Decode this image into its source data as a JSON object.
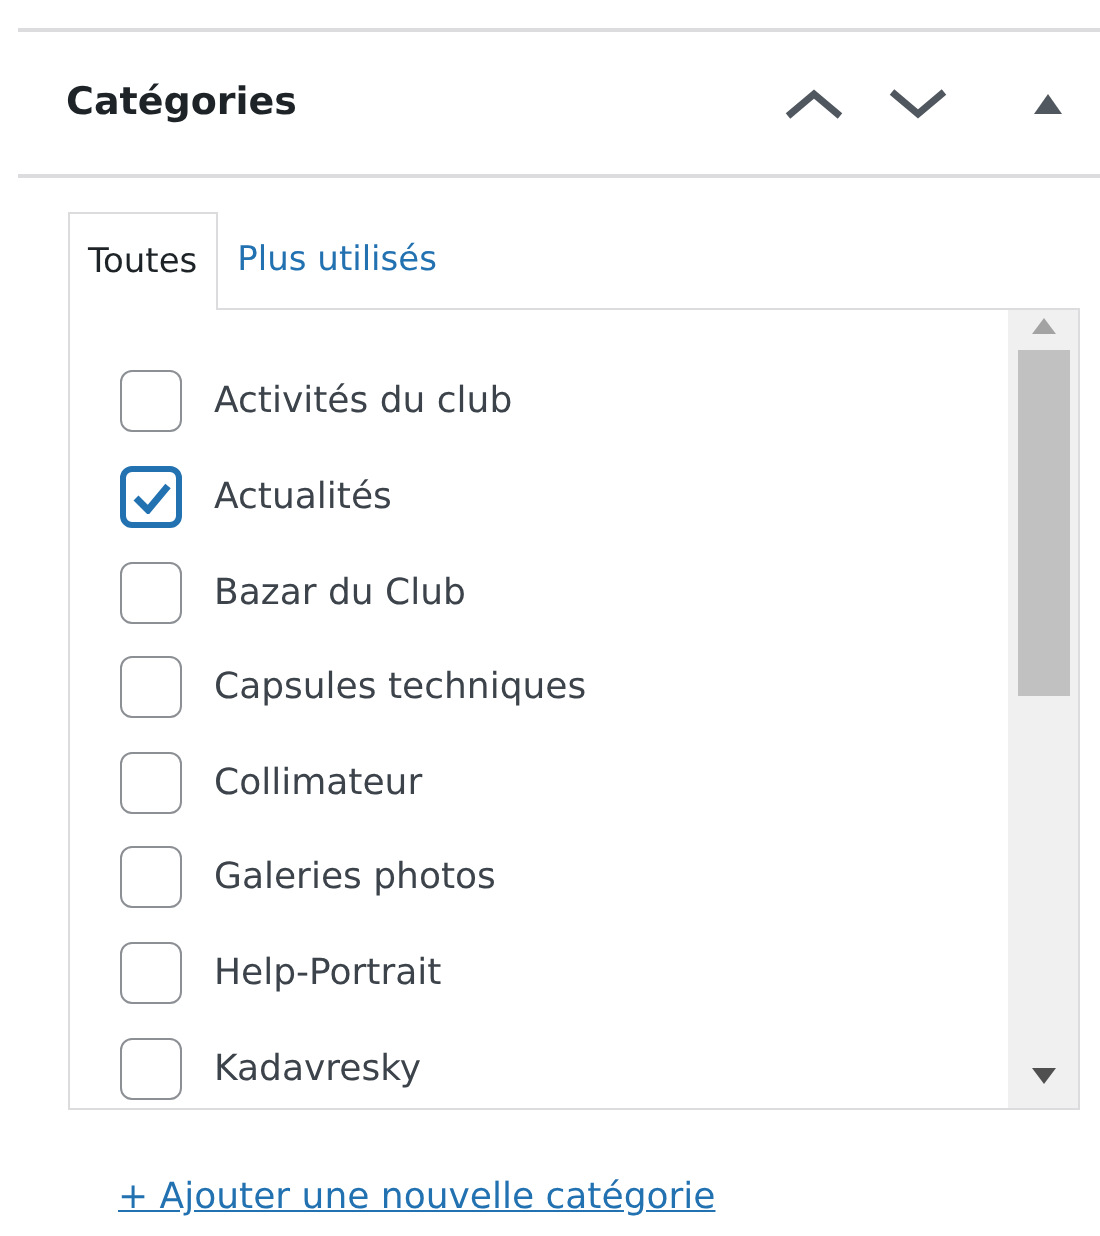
{
  "panel": {
    "title": "Catégories"
  },
  "tabs": [
    {
      "label": "Toutes",
      "selected": true
    },
    {
      "label": "Plus utilisés",
      "selected": false
    }
  ],
  "categories": [
    {
      "label": "Activités du club",
      "checked": false
    },
    {
      "label": "Actualités",
      "checked": true
    },
    {
      "label": "Bazar du Club",
      "checked": false
    },
    {
      "label": "Capsules techniques",
      "checked": false
    },
    {
      "label": "Collimateur",
      "checked": false
    },
    {
      "label": "Galeries photos",
      "checked": false
    },
    {
      "label": "Help-Portrait",
      "checked": false
    },
    {
      "label": "Kadavresky",
      "checked": false
    }
  ],
  "add_link": "+ Ajouter une nouvelle catégorie"
}
